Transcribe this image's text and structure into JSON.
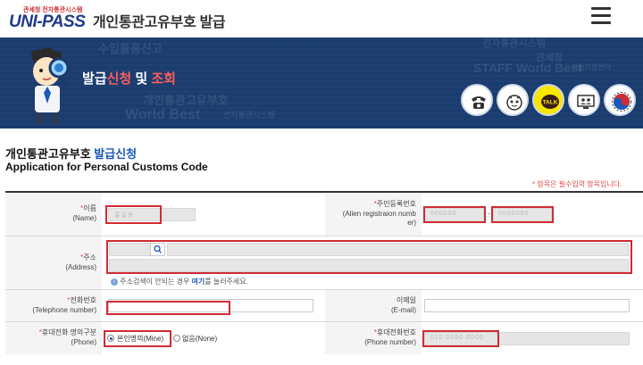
{
  "header": {
    "logo_small": "관세청 전자통관시스템",
    "logo_brand": "UNI-PASS",
    "site_title": "개인통관고유부호 발급"
  },
  "banner": {
    "title_part1": "발급",
    "title_part2": "신청",
    "title_part3": " 및 ",
    "title_part4": "조회",
    "bg_words": [
      "수입물품신고",
      "개인통관고유부호",
      "World Best",
      "전자통관시스템",
      "관세청",
      "STAFF World Best",
      "기술지원센터",
      "전자통관시스템"
    ],
    "icons": [
      "phone-icon",
      "chatbot-icon",
      "kakaotalk-icon",
      "remote-support-icon",
      "taegeuk-icon"
    ],
    "talk_label": "TALK"
  },
  "page": {
    "heading_ko_1": "개인통관고유부호 ",
    "heading_ko_2": "발급신청",
    "heading_en": "Application for Personal Customs Code",
    "required_note": "* 항목은 필수입력 항목입니다."
  },
  "form": {
    "name": {
      "label_ko": "이름",
      "label_en": "(Name)",
      "value": "홍길동"
    },
    "alien_reg": {
      "label_ko": "주민등록번호",
      "label_en_1": "(Alien registraion numb",
      "label_en_2": "er)",
      "value_front": "000000",
      "value_back": "0000000"
    },
    "address": {
      "label_ko": "주소",
      "label_en": "(Address)",
      "hint_1": "주소검색이 안되는 경우 ",
      "hint_link": "여기",
      "hint_2": "를 눌러주세요."
    },
    "telephone": {
      "label_ko": "전화번호",
      "label_en": "(Telephone number)"
    },
    "email": {
      "label_ko": "이메일",
      "label_en": "(E-mail)"
    },
    "phone_owner": {
      "label_ko": "휴대전화 명의구분",
      "label_en": "(Phone)",
      "option_mine": "본인명의(Mine)",
      "option_none": "없음(None)"
    },
    "phone_number": {
      "label_ko": "휴대전화번호",
      "label_en": "(Phone number)",
      "value": "010 0000 0000"
    }
  },
  "colors": {
    "banner_bg": "#1a3c6e",
    "accent_red": "#d02b33",
    "link_blue": "#1b58b8"
  }
}
